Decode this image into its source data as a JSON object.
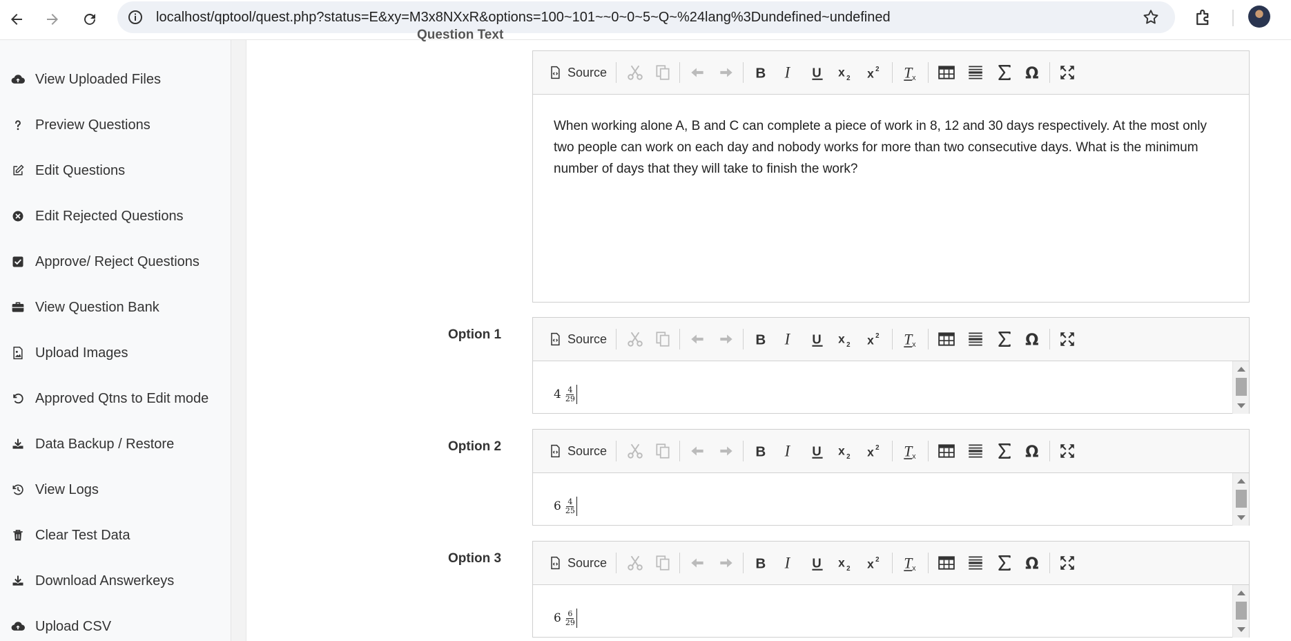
{
  "browser": {
    "url": "localhost/qptool/quest.php?status=E&xy=M3x8NXxR&options=100~101~~0~0~5~Q~%24lang%3Dundefined~undefined"
  },
  "sidebar": {
    "items": [
      {
        "label": "View Uploaded Files",
        "icon": "cloud-upload-icon"
      },
      {
        "label": "Preview Questions",
        "icon": "question-icon"
      },
      {
        "label": "Edit Questions",
        "icon": "edit-icon"
      },
      {
        "label": "Edit Rejected Questions",
        "icon": "times-circle-icon"
      },
      {
        "label": "Approve/ Reject Questions",
        "icon": "check-square-icon"
      },
      {
        "label": "View Question Bank",
        "icon": "briefcase-icon"
      },
      {
        "label": "Upload Images",
        "icon": "image-icon"
      },
      {
        "label": "Approved Qtns to Edit mode",
        "icon": "undo-icon"
      },
      {
        "label": "Data Backup / Restore",
        "icon": "download-icon"
      },
      {
        "label": "View Logs",
        "icon": "history-icon"
      },
      {
        "label": "Clear Test Data",
        "icon": "trash-icon"
      },
      {
        "label": "Download Answerkeys",
        "icon": "download-icon"
      },
      {
        "label": "Upload CSV",
        "icon": "cloud-upload-icon"
      }
    ]
  },
  "toolbar": {
    "source_label": "Source"
  },
  "question": {
    "label": "Question Text",
    "text": "When working alone A, B and C can complete a piece of work in 8, 12 and 30 days respectively. At the most only two people can work on each day and nobody works for more than two consecutive days. What is the minimum number of days that they will take to finish the work?"
  },
  "options": [
    {
      "label": "Option 1",
      "whole": "4",
      "numerator": "4",
      "denominator": "29"
    },
    {
      "label": "Option 2",
      "whole": "6",
      "numerator": "4",
      "denominator": "25"
    },
    {
      "label": "Option 3",
      "whole": "6",
      "numerator": "6",
      "denominator": "29"
    }
  ]
}
